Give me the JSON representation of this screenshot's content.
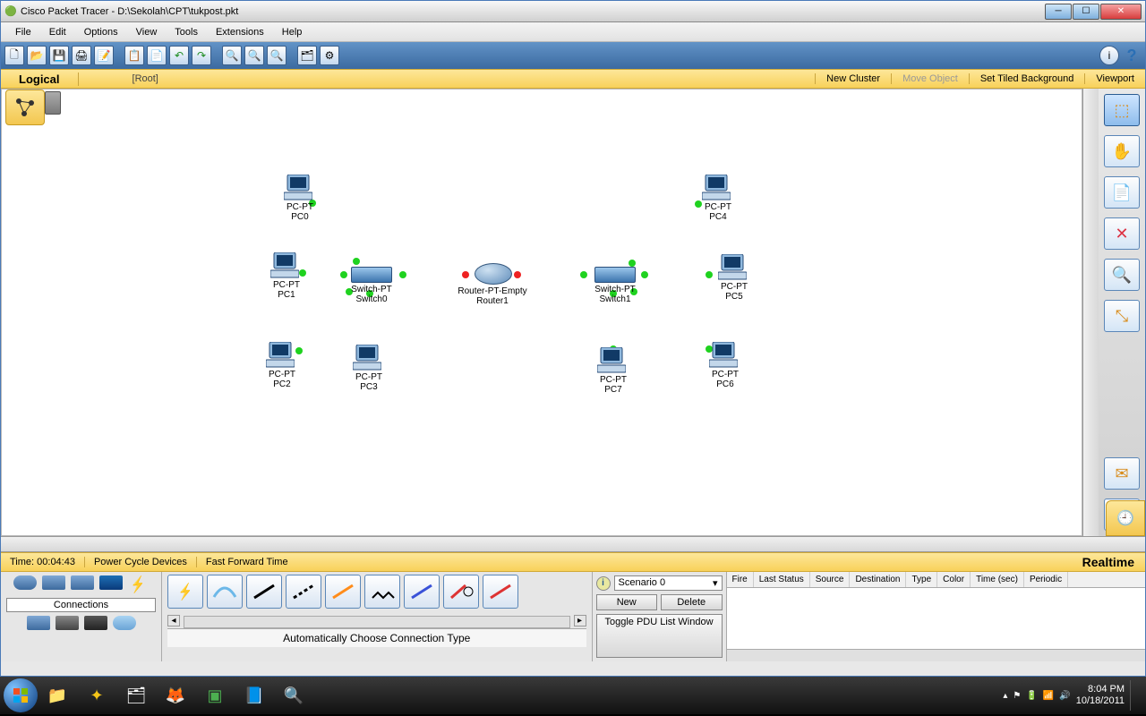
{
  "titlebar": {
    "app": "Cisco Packet Tracer",
    "path": "D:\\Sekolah\\CPT\\tukpost.pkt"
  },
  "menu": [
    "File",
    "Edit",
    "Options",
    "View",
    "Tools",
    "Extensions",
    "Help"
  ],
  "viewbar": {
    "mode": "Logical",
    "root": "[Root]",
    "new_cluster": "New Cluster",
    "move_object": "Move Object",
    "set_bg": "Set Tiled Background",
    "viewport": "Viewport"
  },
  "timebar": {
    "time": "Time: 00:04:43",
    "pcd": "Power Cycle Devices",
    "fft": "Fast Forward Time",
    "mode": "Realtime"
  },
  "connections": {
    "label": "Connections",
    "auto": "Automatically Choose Connection Type"
  },
  "scenario": {
    "label": "Scenario 0",
    "new": "New",
    "del": "Delete",
    "toggle": "Toggle PDU List Window"
  },
  "pdu_headers": [
    "Fire",
    "Last Status",
    "Source",
    "Destination",
    "Type",
    "Color",
    "Time (sec)",
    "Periodic"
  ],
  "nodes": {
    "pc0": {
      "t": "PC-PT",
      "n": "PC0"
    },
    "pc1": {
      "t": "PC-PT",
      "n": "PC1"
    },
    "pc2": {
      "t": "PC-PT",
      "n": "PC2"
    },
    "pc3": {
      "t": "PC-PT",
      "n": "PC3"
    },
    "pc4": {
      "t": "PC-PT",
      "n": "PC4"
    },
    "pc5": {
      "t": "PC-PT",
      "n": "PC5"
    },
    "pc6": {
      "t": "PC-PT",
      "n": "PC6"
    },
    "pc7": {
      "t": "PC-PT",
      "n": "PC7"
    },
    "sw0": {
      "t": "Switch-PT",
      "n": "Switch0"
    },
    "sw1": {
      "t": "Switch-PT",
      "n": "Switch1"
    },
    "r1": {
      "t": "Router-PT-Empty",
      "n": "Router1"
    }
  },
  "tray": {
    "time": "8:04 PM",
    "date": "10/18/2011"
  }
}
